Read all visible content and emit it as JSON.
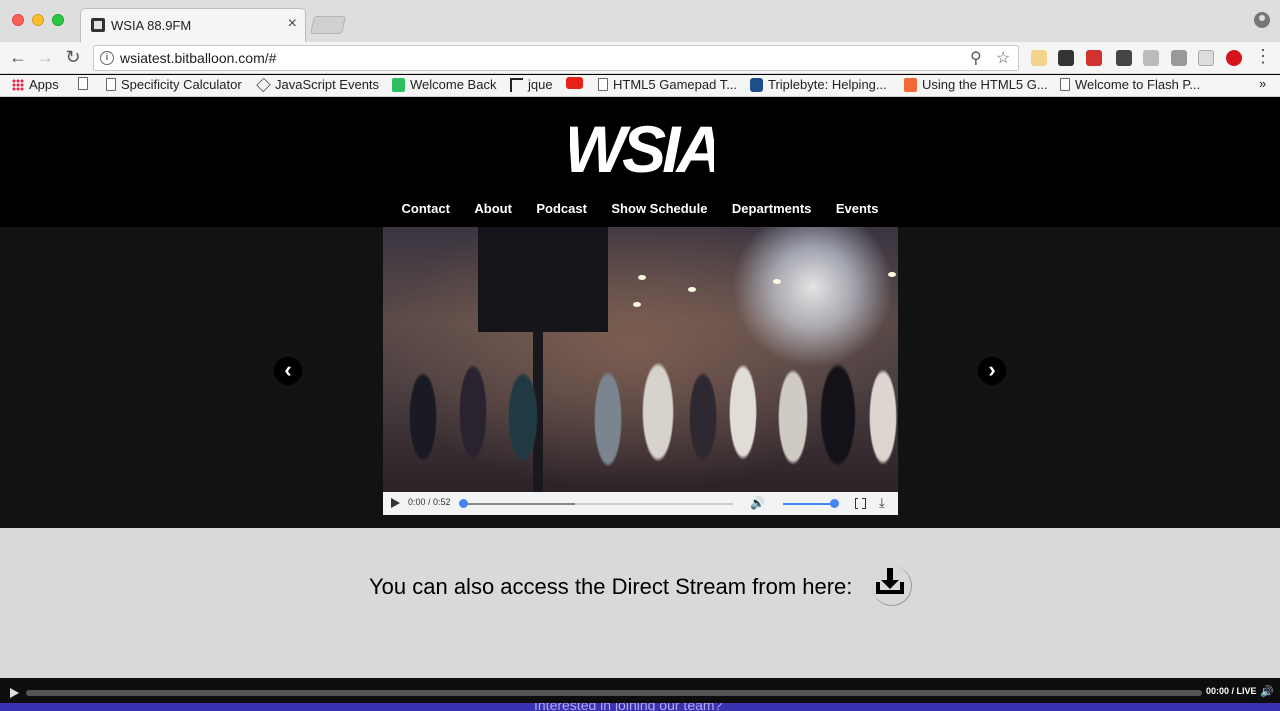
{
  "browser": {
    "tab_title": "WSIA 88.9FM",
    "url": "wsiatest.bitballoon.com/#",
    "bookmarks": [
      {
        "label": "Apps",
        "icon": "apps-grid-icon"
      },
      {
        "label": "",
        "icon": "document-icon"
      },
      {
        "label": "Specificity Calculator",
        "icon": "document-icon"
      },
      {
        "label": "JavaScript Events",
        "icon": "diamond-icon"
      },
      {
        "label": "Welcome Back",
        "icon": "evernote-icon"
      },
      {
        "label": "jque",
        "icon": "jquery-icon"
      },
      {
        "label": "",
        "icon": "youtube-icon"
      },
      {
        "label": "HTML5 Gamepad T...",
        "icon": "document-icon"
      },
      {
        "label": "Triplebyte: Helping...",
        "icon": "hexagon-icon"
      },
      {
        "label": "Using the HTML5 G...",
        "icon": "plus-icon"
      },
      {
        "label": "Welcome to Flash P...",
        "icon": "document-icon"
      }
    ]
  },
  "site": {
    "logo_text": "WSIA",
    "nav": [
      "Contact",
      "About",
      "Podcast",
      "Show Schedule",
      "Departments",
      "Events"
    ],
    "video": {
      "time": "0:00 / 0:52",
      "progress": 0,
      "volume": 1.0
    },
    "prev_arrow": "‹",
    "next_arrow": "›",
    "stream_text": "You can also access the Direct Stream from here:",
    "live_player": {
      "time": "00:00 / LIVE"
    },
    "footer_text": "Interested in joining our team?"
  },
  "colors": {
    "page_bg": "#000000",
    "stream_section_bg": "#d9d9d9",
    "footer_bar": "#3a32b0",
    "accent_blue": "#4285f4"
  }
}
